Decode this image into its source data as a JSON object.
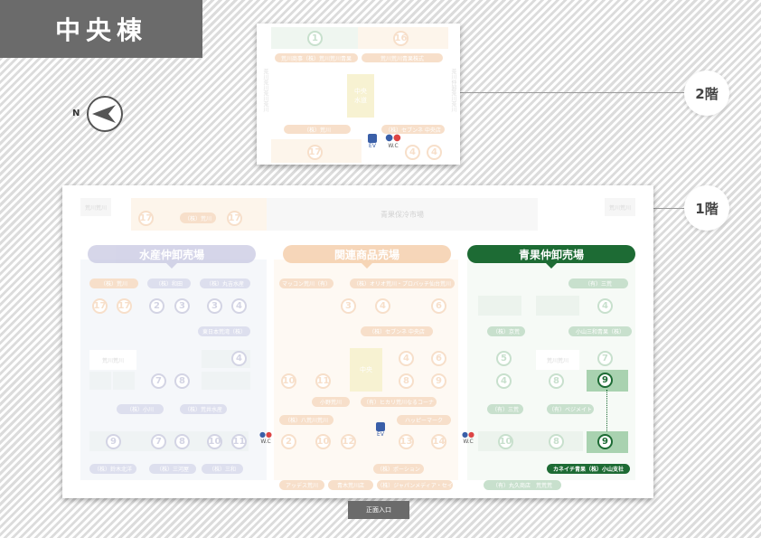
{
  "building_title": "中央棟",
  "north_label": "N",
  "floor2": {
    "label": "2階",
    "nums_top": [
      "1",
      "16"
    ],
    "pills_top": [
      "荒川商事（株）荒川荒川青果",
      "荒川荒川青果株式"
    ],
    "side_left": "荒川荒川荒川荒川",
    "side_right": "荒川仲卸荒川荒川",
    "center_block": "中央\n水道",
    "pills_bottom": [
      "（株）荒川",
      "（株）セブンネ 中央店"
    ],
    "nums_bottom": [
      "17",
      "4",
      "4"
    ],
    "ev": "EV",
    "wc": "W.C"
  },
  "floor1": {
    "label": "1階",
    "top_row": {
      "left_box": "荒川荒川",
      "right_box": "荒川荒川",
      "center_label": "青果保冷市場",
      "nums": [
        "17",
        "17"
      ],
      "pill": "（株）荒川"
    },
    "sections": {
      "seafood": {
        "header": "水産仲卸売場",
        "color": "#c4c4e0",
        "pills": [
          "（株）荒川",
          "（株）和田",
          "（株）丸吉水産",
          "東日本荒湾（株）",
          "（株）小川",
          "（株）荒井水産",
          "（株）鈴木北洋",
          "（株）三河屋",
          "（株）三和"
        ],
        "nums": [
          "17",
          "17",
          "2",
          "3",
          "3",
          "4",
          "4",
          "7",
          "8",
          "9",
          "7",
          "8",
          "10",
          "11"
        ],
        "inner_box": "荒川荒川"
      },
      "related": {
        "header": "関連商品売場",
        "color": "#f4c9a2",
        "pills": [
          "マッコン荒川（有）",
          "（株）オリオ荒川・プロバッチ仙台荒川",
          "（株）セブンネ 中央店",
          "小野荒川",
          "（有）ヒカリ荒川なるコーナ",
          "（株）八荒川荒川",
          "ハッピーマーク",
          "（株）ポーション",
          "アッデス荒川",
          "青木荒川店",
          "（株）ジャパンメディア・セイ"
        ],
        "nums": [
          "3",
          "4",
          "6",
          "4",
          "6",
          "10",
          "11",
          "8",
          "9",
          "2",
          "10",
          "12",
          "13",
          "14"
        ],
        "center": "中央"
      },
      "produce": {
        "header": "青果仲卸売場",
        "color": "#1d6b34",
        "pills": [
          "（有）三荒",
          "（株）京荒",
          "小山三和青果（株）",
          "（有）三荒",
          "（有）ベジメイト",
          "（有）丸久商店　荒荒荒"
        ],
        "nums": [
          "4",
          "5",
          "7",
          "4",
          "8",
          "9",
          "10",
          "8",
          "9"
        ],
        "inner_box": "荒川荒川",
        "highlight_pill": "カネイチ青果（株）小山支社",
        "highlight_number": "9"
      }
    },
    "ev": "EV",
    "wc": "W.C"
  },
  "entrance_label": "正面入口"
}
